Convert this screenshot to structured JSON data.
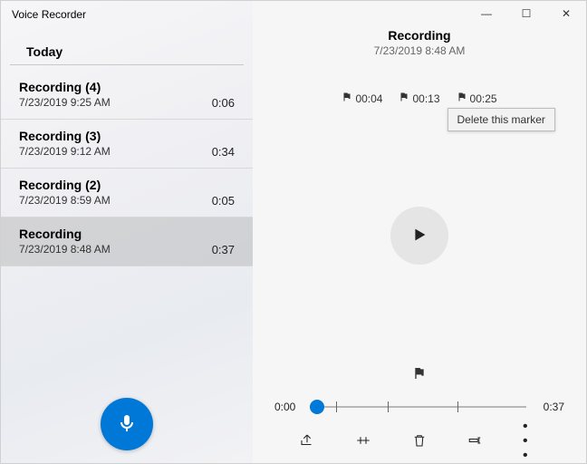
{
  "app_title": "Voice Recorder",
  "section_heading": "Today",
  "recordings": [
    {
      "title": "Recording (4)",
      "date": "7/23/2019 9:25 AM",
      "duration": "0:06"
    },
    {
      "title": "Recording (3)",
      "date": "7/23/2019 9:12 AM",
      "duration": "0:34"
    },
    {
      "title": "Recording (2)",
      "date": "7/23/2019 8:59 AM",
      "duration": "0:05"
    },
    {
      "title": "Recording",
      "date": "7/23/2019 8:48 AM",
      "duration": "0:37"
    }
  ],
  "selected_index": 3,
  "detail": {
    "title": "Recording",
    "date": "7/23/2019 8:48 AM",
    "markers": [
      "00:04",
      "00:13",
      "00:25"
    ],
    "tooltip": "Delete this marker",
    "playback_position": "0:00",
    "total_duration": "0:37"
  },
  "win_controls": {
    "minimize": "—",
    "maximize": "☐",
    "close": "✕"
  },
  "more_label": "• • •"
}
